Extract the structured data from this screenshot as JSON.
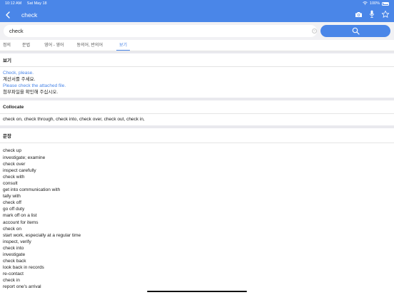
{
  "status_bar": {
    "time": "10:12 AM",
    "date": "Sat May 18",
    "battery": "100%"
  },
  "nav": {
    "title": "check"
  },
  "search": {
    "value": "check",
    "placeholder": ""
  },
  "tabs": [
    {
      "label": "정의"
    },
    {
      "label": "문법"
    },
    {
      "label": "영어 - 영어"
    },
    {
      "label": "동의어, 반의어"
    },
    {
      "label": "보기"
    }
  ],
  "examples": {
    "title": "보기",
    "items": [
      {
        "en": "Check, please.",
        "ko": "계산서를 주세요."
      },
      {
        "en": "Please check the attached file.",
        "ko": "첨부파일을 확인해 주십시오."
      }
    ]
  },
  "collocate": {
    "title": "Collocate",
    "text": "check on, check through, check into, check over, check out, check in,"
  },
  "sentences": {
    "title": "문장",
    "items": [
      "check up",
      "investigate; examine",
      "check over",
      "inspect carefully",
      "check with",
      "consult",
      "get into communication with",
      "tally with",
      "check off",
      "go off duty",
      "mark off on a list",
      "account for items",
      "check on",
      "start work, especially at a regular time",
      "inspect, verify",
      "check into",
      "investigate",
      "check back",
      "look back in records",
      "re-contact",
      "check in",
      "report one's arrival"
    ]
  },
  "colors": {
    "accent": "#4a86e8",
    "divider": "#e9e9ee"
  }
}
